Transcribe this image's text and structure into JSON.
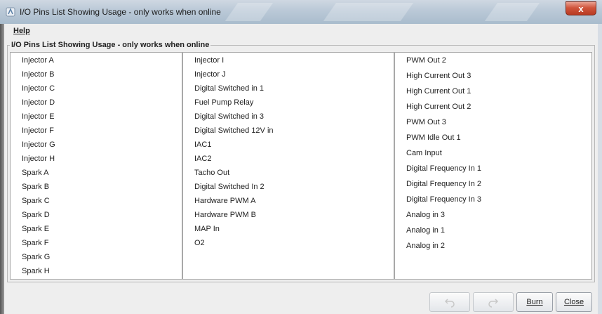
{
  "window": {
    "title": "I/O Pins List Showing Usage - only works when online",
    "close_label": "x"
  },
  "menu": {
    "help": "Help"
  },
  "group": {
    "title": "I/O Pins List Showing Usage - only works when online"
  },
  "columns": [
    [
      "Injector A",
      "Injector B",
      "Injector C",
      "Injector D",
      "Injector E",
      "Injector F",
      "Injector G",
      "Injector H",
      "Spark A",
      "Spark B",
      "Spark C",
      "Spark D",
      "Spark E",
      "Spark F",
      "Spark G",
      "Spark H"
    ],
    [
      "Injector I",
      "Injector J",
      "Digital Switched in 1",
      "Fuel Pump Relay",
      "Digital Switched in 3",
      "Digital Switched 12V in",
      "IAC1",
      "IAC2",
      "Tacho Out",
      "Digital Switched In 2",
      "Hardware PWM A",
      "Hardware PWM B",
      "MAP In",
      "O2"
    ],
    [
      "PWM Out 2",
      "High Current Out 3",
      "High Current Out 1",
      "High Current Out 2",
      "PWM Out 3",
      "PWM Idle Out 1",
      "Cam Input",
      "Digital Frequency In 1",
      "Digital Frequency In 2",
      "Digital Frequency In 3",
      "Analog in 3",
      "Analog in 1",
      "Analog in 2"
    ]
  ],
  "buttons": {
    "undo_icon": "undo-icon",
    "redo_icon": "redo-icon",
    "burn": "Burn",
    "close": "Close"
  }
}
